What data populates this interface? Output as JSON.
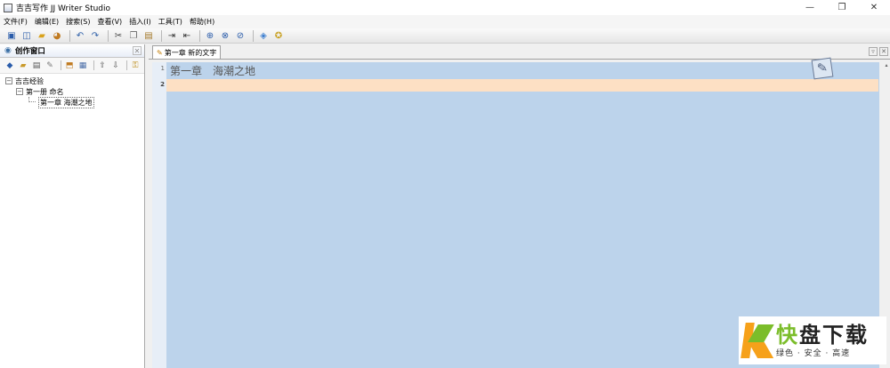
{
  "window": {
    "title": "吉吉写作 JJ Writer Studio",
    "controls": {
      "minimize": "—",
      "restore": "❐",
      "close": "✕"
    }
  },
  "menu": [
    "文件(F)",
    "编辑(E)",
    "搜索(S)",
    "查看(V)",
    "插入(I)",
    "工具(T)",
    "帮助(H)"
  ],
  "toolbar": {
    "icons": [
      "save-icon",
      "save-all-icon",
      "open-icon",
      "print-icon",
      "undo-icon",
      "redo-icon",
      "cut-icon",
      "copy-icon",
      "paste-icon",
      "indent-icon",
      "outdent-icon",
      "find-icon",
      "find-next-icon",
      "replace-icon",
      "settings-icon",
      "help-icon"
    ]
  },
  "left_panel": {
    "title": "创作窗口",
    "close": "✕",
    "tree": {
      "root": "吉吉经验",
      "book": "第一册 命名",
      "chapter": "第一章 海潮之地"
    }
  },
  "editor": {
    "tab_label": "第一章 新的文字",
    "line_numbers": [
      "1",
      "2"
    ],
    "heading_part1": "第一章",
    "heading_part2": "海潮之地"
  },
  "watermark": {
    "main_green": "快",
    "main_dark": "盘下载",
    "sub": "绿色 · 安全 · 高速"
  },
  "colors": {
    "editor_background": "#bcd3eb",
    "current_line": "#fde0c4",
    "watermark_green": "#7bbd2a",
    "watermark_orange": "#f6a11a"
  }
}
